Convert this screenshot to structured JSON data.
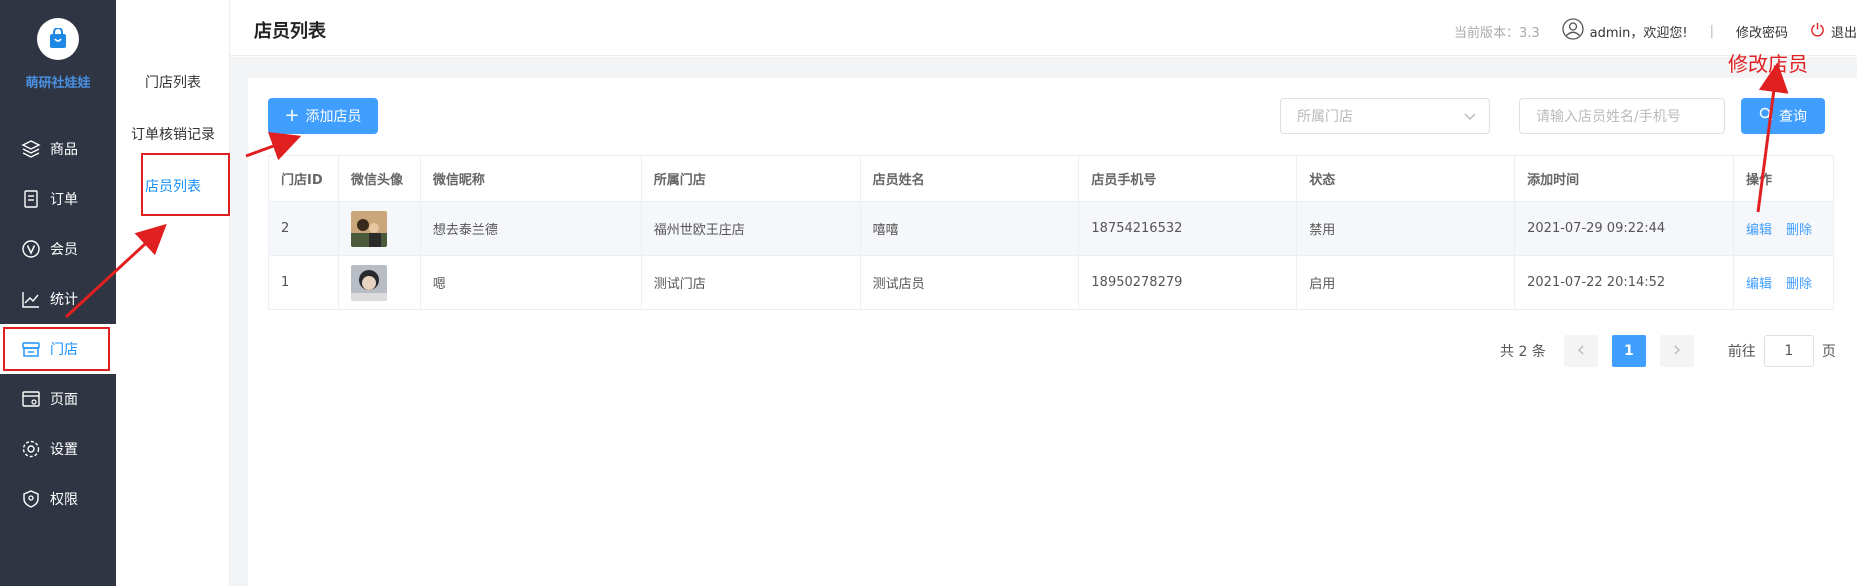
{
  "brand": {
    "name": "萌研社娃娃"
  },
  "sidebar": {
    "items": [
      {
        "label": "商品",
        "icon": "layers-icon"
      },
      {
        "label": "订单",
        "icon": "document-icon"
      },
      {
        "label": "会员",
        "icon": "member-v-icon"
      },
      {
        "label": "统计",
        "icon": "chart-line-icon"
      },
      {
        "label": "门店",
        "icon": "store-icon",
        "active": true
      },
      {
        "label": "页面",
        "icon": "page-icon"
      },
      {
        "label": "设置",
        "icon": "gear-icon"
      },
      {
        "label": "权限",
        "icon": "shield-icon"
      }
    ]
  },
  "submenu": {
    "items": [
      {
        "label": "门店列表"
      },
      {
        "label": "订单核销记录"
      },
      {
        "label": "店员列表",
        "active": true
      }
    ]
  },
  "header": {
    "title": "店员列表",
    "version": "当前版本：3.3",
    "welcome": "admin，欢迎您!",
    "separator": "|",
    "change_password": "修改密码",
    "logout": "退出"
  },
  "toolbar": {
    "add_label": "添加店员",
    "store_select_placeholder": "所属门店",
    "search_placeholder": "请输入店员姓名/手机号",
    "search_label": "查询"
  },
  "table": {
    "columns": [
      "门店ID",
      "微信头像",
      "微信昵称",
      "所属门店",
      "店员姓名",
      "店员手机号",
      "状态",
      "添加时间",
      "操作"
    ],
    "rows": [
      {
        "store_id": "2",
        "nickname": "想去泰兰德",
        "store": "福州世欧王庄店",
        "name": "嘻嘻",
        "phone": "18754216532",
        "status": "禁用",
        "added": "2021-07-29 09:22:44",
        "edit": "编辑",
        "delete": "删除"
      },
      {
        "store_id": "1",
        "nickname": "嗯",
        "store": "测试门店",
        "name": "测试店员",
        "phone": "18950278279",
        "status": "启用",
        "added": "2021-07-22 20:14:52",
        "edit": "编辑",
        "delete": "删除"
      }
    ]
  },
  "pagination": {
    "total": "共 2 条",
    "current": "1",
    "goto_prefix": "前往",
    "goto_value": "1",
    "goto_suffix": "页"
  },
  "annotation": {
    "label": "修改店员"
  },
  "colors": {
    "sidebar_bg": "#2f3542",
    "primary": "#409eff",
    "annotation": "#e02020",
    "enabled": "#67c23a"
  }
}
